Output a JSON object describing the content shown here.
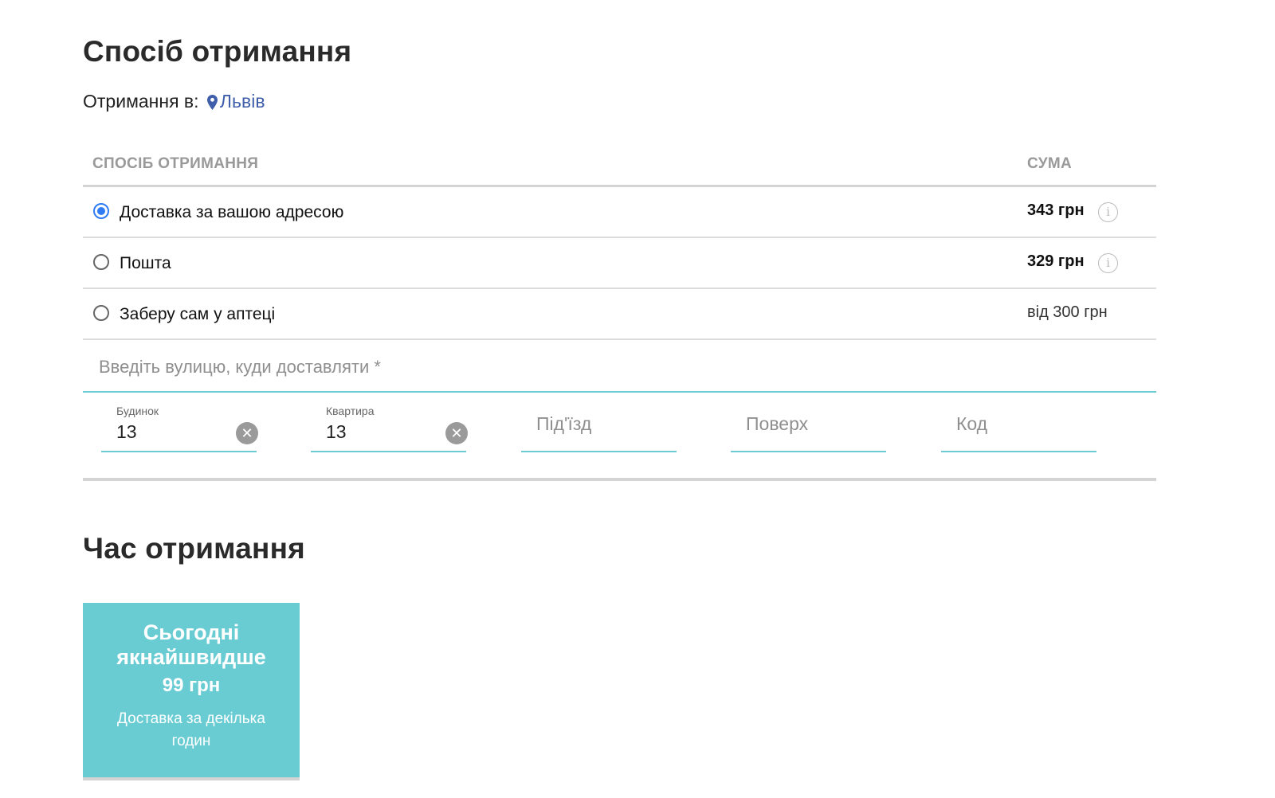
{
  "delivery_section": {
    "title": "Спосіб отримання",
    "city_prefix": "Отримання в:",
    "city": "Львів",
    "table_headers": {
      "method": "СПОСІБ ОТРИМАННЯ",
      "sum": "СУМА"
    },
    "options": [
      {
        "label": "Доставка за вашою адресою",
        "price": "343 грн",
        "selected": true,
        "info_icon": "info-icon"
      },
      {
        "label": "Пошта",
        "price": "329 грн",
        "selected": false,
        "info_icon": "info-icon"
      },
      {
        "label": "Заберу сам у аптеці",
        "price": "від 300 грн",
        "selected": false
      }
    ]
  },
  "address_form": {
    "street_placeholder": "Введіть вулицю, куди доставляти *",
    "house": {
      "label": "Будинок",
      "value": "13"
    },
    "apartment": {
      "label": "Квартира",
      "value": "13"
    },
    "entrance_placeholder": "Під'їзд",
    "floor_placeholder": "Поверх",
    "code_placeholder": "Код"
  },
  "time_section": {
    "title": "Час отримання",
    "card": {
      "title": "Сьогодні якнайшвидше",
      "price": "99 грн",
      "description": "Доставка за декілька годин"
    }
  },
  "colors": {
    "accent": "#6accd3",
    "radio_selected": "#2f7cf6",
    "link": "#3f5faa"
  }
}
